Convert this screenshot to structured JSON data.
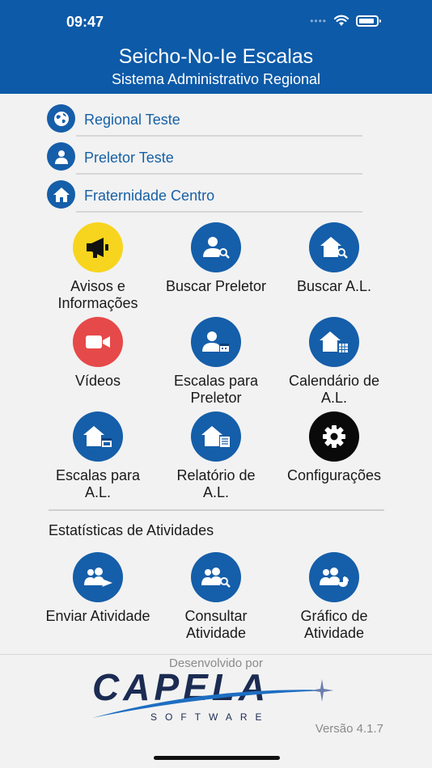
{
  "status_bar": {
    "time": "09:47"
  },
  "header": {
    "title": "Seicho-No-Ie Escalas",
    "subtitle": "Sistema Administrativo Regional"
  },
  "info_rows": [
    {
      "icon": "globe-icon",
      "label": "Regional Teste"
    },
    {
      "icon": "person-icon",
      "label": "Preletor Teste"
    },
    {
      "icon": "home-icon",
      "label": "Fraternidade Centro"
    }
  ],
  "menu": [
    {
      "label_1": "Avisos e",
      "label_2": "Informações",
      "icon": "megaphone-icon",
      "color": "#f7d51e"
    },
    {
      "label_1": "Buscar Preletor",
      "label_2": "",
      "icon": "person-search-icon",
      "color": "#155ea9"
    },
    {
      "label_1": "Buscar A.L.",
      "label_2": "",
      "icon": "house-search-icon",
      "color": "#155ea9"
    },
    {
      "label_1": "Vídeos",
      "label_2": "",
      "icon": "video-camera-icon",
      "color": "#e64949"
    },
    {
      "label_1": "Escalas para",
      "label_2": "Preletor",
      "icon": "person-calendar-icon",
      "color": "#155ea9"
    },
    {
      "label_1": "Calendário de",
      "label_2": "A.L.",
      "icon": "house-grid-icon",
      "color": "#155ea9"
    },
    {
      "label_1": "Escalas para",
      "label_2": "A.L.",
      "icon": "house-calendar-icon",
      "color": "#155ea9"
    },
    {
      "label_1": "Relatório de",
      "label_2": "A.L.",
      "icon": "house-report-icon",
      "color": "#155ea9"
    },
    {
      "label_1": "Configurações",
      "label_2": "",
      "icon": "gear-icon",
      "color": "#0a0a0a"
    }
  ],
  "stats": {
    "title": "Estatísticas de Atividades",
    "items": [
      {
        "label_1": "Enviar Atividade",
        "label_2": "",
        "icon": "group-send-icon"
      },
      {
        "label_1": "Consultar",
        "label_2": "Atividade",
        "icon": "group-search-icon"
      },
      {
        "label_1": "Gráfico de",
        "label_2": "Atividade",
        "icon": "group-chart-icon"
      }
    ]
  },
  "footer": {
    "developed_by": "Desenvolvido por",
    "logo_text": "CAPELA",
    "logo_sub": "SOFTWARE",
    "version": "Versão 4.1.7"
  },
  "colors": {
    "header": "#0d5aa8",
    "accent": "#155ea9",
    "text_link": "#1760a6"
  }
}
